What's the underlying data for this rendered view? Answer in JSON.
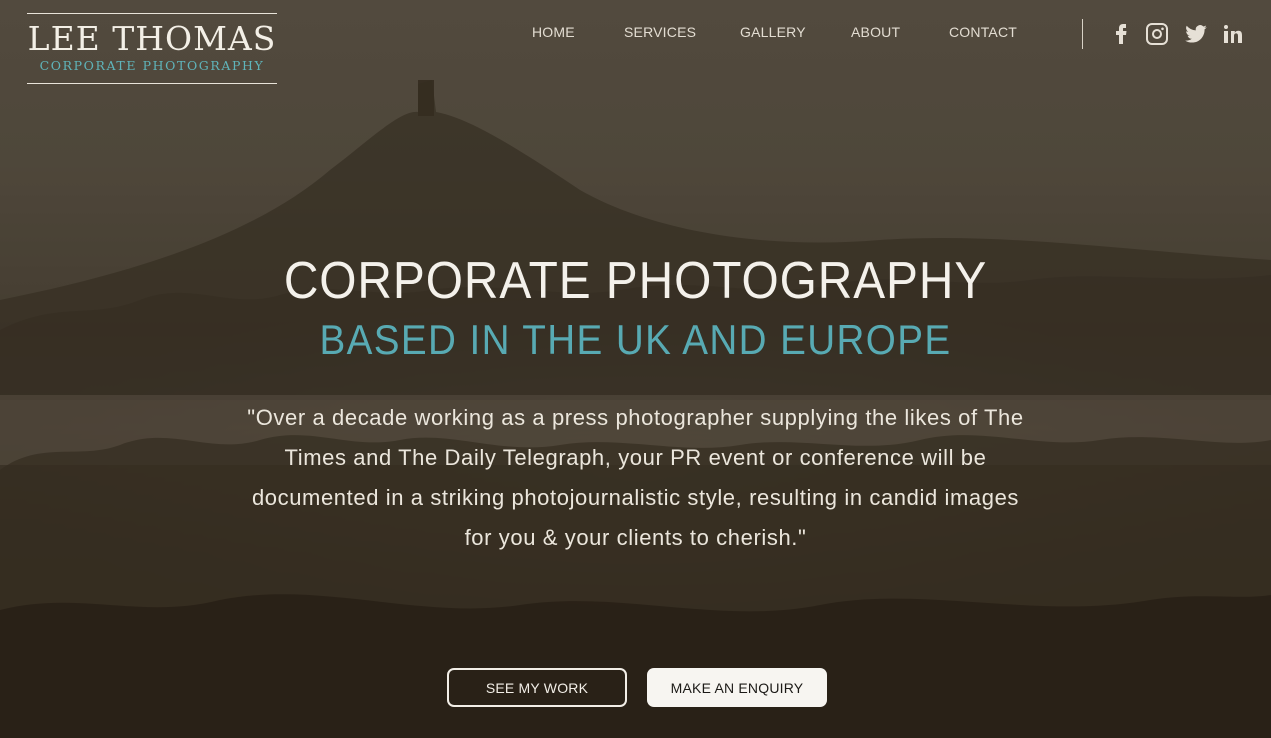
{
  "logo": {
    "name": "LEE THOMAS",
    "tagline": "CORPORATE PHOTOGRAPHY"
  },
  "nav": {
    "items": [
      {
        "label": "HOME"
      },
      {
        "label": "SERVICES"
      },
      {
        "label": "GALLERY"
      },
      {
        "label": "ABOUT"
      },
      {
        "label": "CONTACT"
      }
    ]
  },
  "social": [
    "facebook-icon",
    "instagram-icon",
    "twitter-icon",
    "linkedin-icon"
  ],
  "hero": {
    "title": "CORPORATE PHOTOGRAPHY",
    "subtitle": "BASED IN THE UK AND EUROPE",
    "quote": "\"Over a decade working as a press photographer supplying the likes of The Times and The Daily Telegraph, your PR event or conference will be documented in a striking photojournalistic style, resulting in candid images for you & your clients to cherish.\""
  },
  "buttons": {
    "see_work": "SEE MY WORK",
    "enquiry": "MAKE AN ENQUIRY"
  },
  "colors": {
    "accent": "#58aab3",
    "text_light": "#f4f1eb"
  }
}
